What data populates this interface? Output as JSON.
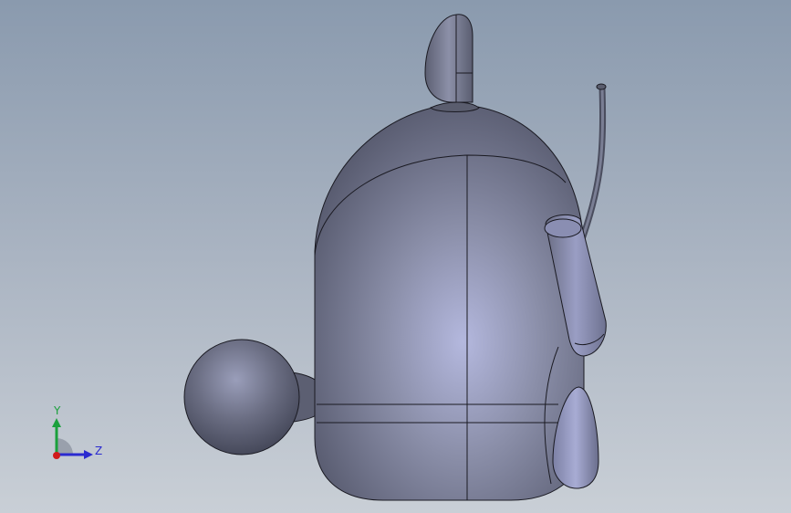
{
  "viewport": {
    "background_top": "#8a9aae",
    "background_bottom": "#c9cfd6"
  },
  "model": {
    "body_color": "#6b6f85",
    "highlight_color": "#b4b8de",
    "edge_color": "#1a1a22"
  },
  "triad": {
    "y_label": "Y",
    "z_label": "Z",
    "y_color": "#1aa03c",
    "z_color": "#2a2ad0",
    "x_color": "#d01a1a"
  }
}
